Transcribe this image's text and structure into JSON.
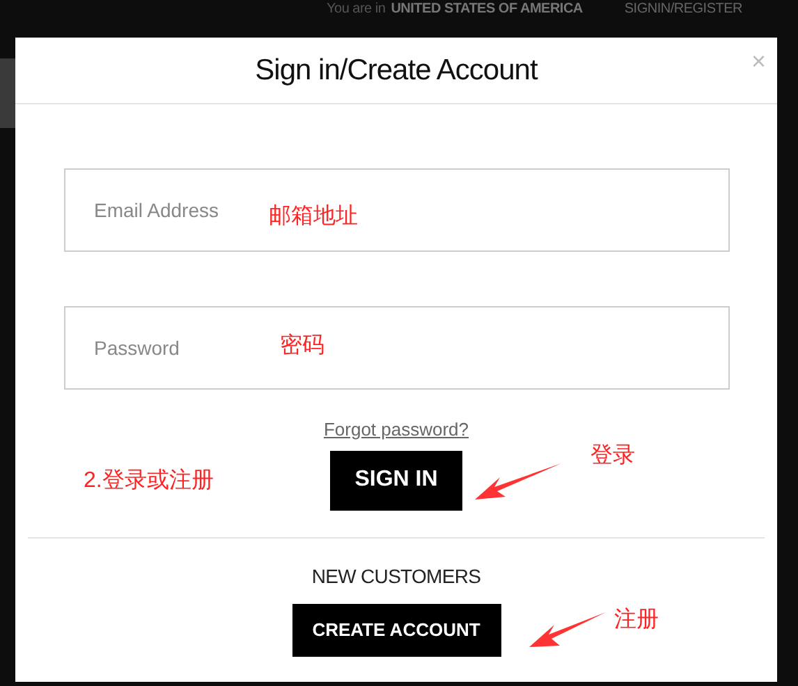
{
  "top_bar": {
    "location_label": "You are in",
    "location": "UNITED STATES OF AMERICA",
    "account_link": "SIGNIN/REGISTER"
  },
  "modal": {
    "title": "Sign in/Create Account",
    "close": "×",
    "email": {
      "placeholder": "Email Address"
    },
    "password": {
      "placeholder": "Password"
    },
    "forgot_link": "Forgot password?",
    "sign_in_button": "SIGN IN",
    "new_customers_heading": "NEW CUSTOMERS",
    "create_account_button": "CREATE ACCOUNT"
  },
  "annotations": [
    {
      "text": "邮箱地址"
    },
    {
      "text": "密码"
    },
    {
      "text": "2.登录或注册"
    },
    {
      "text": "登录"
    },
    {
      "text": "注册"
    }
  ]
}
